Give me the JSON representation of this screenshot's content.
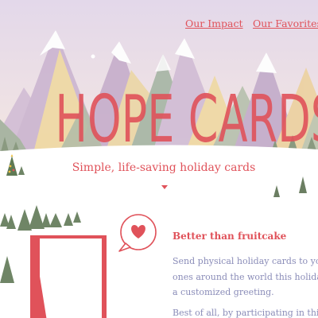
{
  "nav": {
    "items": [
      {
        "label": "Our Impact"
      },
      {
        "label": "Our Favorites"
      }
    ]
  },
  "hero": {
    "title": "HOPE CARDS",
    "subtitle": "Simple, life-saving holiday cards"
  },
  "feature": {
    "heading": "Better than fruitcake",
    "paragraph_lines": [
      "Send physical holiday cards to your frien",
      "ones around the world this holiday seaso",
      "a customized greeting."
    ],
    "paragraph2_line": "Best of all, by participating in this campa"
  },
  "colors": {
    "accent": "#e0525a",
    "body_text": "#8a8cb8",
    "sky_top": "#e6dcec",
    "sky_bottom": "#f4e6dc"
  },
  "icons": {
    "chat_heart": "heart-speech-bubble",
    "caret": "chevron-down"
  }
}
